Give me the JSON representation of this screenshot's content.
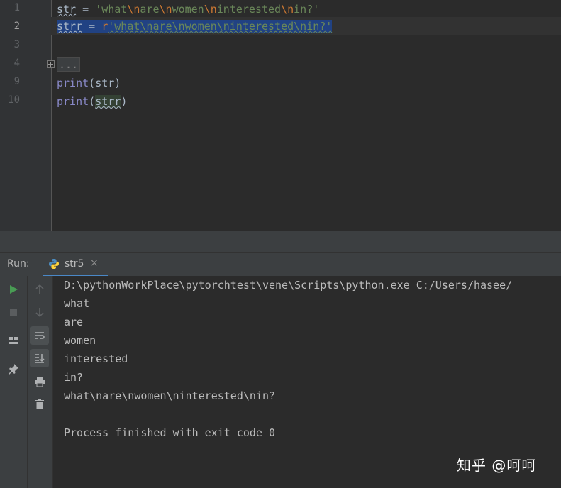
{
  "editor": {
    "line_numbers": [
      "1",
      "2",
      "3",
      "4",
      "9",
      "10"
    ],
    "line1": {
      "var": "str",
      "op": " = ",
      "q1": "'what",
      "e1": "\\n",
      "s1": "are",
      "e2": "\\n",
      "s2": "women",
      "e3": "\\n",
      "s3": "interested",
      "e4": "\\n",
      "s4": "in?'"
    },
    "line2": {
      "var": "strr",
      "op": " = ",
      "prefix": "r",
      "str": "'what\\nare\\nwomen\\ninterested\\nin?'"
    },
    "folded": "...",
    "line9": {
      "fn": "print",
      "open": "(",
      "arg": "str",
      "close": ")"
    },
    "line10": {
      "fn": "print",
      "open": "(",
      "arg": "strr",
      "close": ")"
    }
  },
  "run_panel": {
    "label": "Run:",
    "tab_label": "str5",
    "tab_close": "×",
    "left_icons": [
      "play-icon",
      "stop-icon",
      "layout-icon",
      "pin-icon"
    ],
    "toolbar_icons": [
      "up-arrow-icon",
      "down-arrow-icon",
      "soft-wrap-icon",
      "scroll-to-end-icon",
      "print-icon",
      "trash-icon"
    ]
  },
  "console": {
    "lines": [
      "D:\\pythonWorkPlace\\pytorchtest\\vene\\Scripts\\python.exe C:/Users/hasee/",
      "what",
      "are",
      "women",
      "interested",
      "in?",
      "what\\nare\\nwomen\\ninterested\\nin?",
      "",
      "Process finished with exit code 0"
    ]
  },
  "watermark": "知乎 @呵呵",
  "colors": {
    "background": "#2b2b2b",
    "string": "#6a8759",
    "escape": "#cc7832",
    "builtin": "#8888c6",
    "selection": "#214283",
    "tab_accent": "#4a88c7"
  }
}
